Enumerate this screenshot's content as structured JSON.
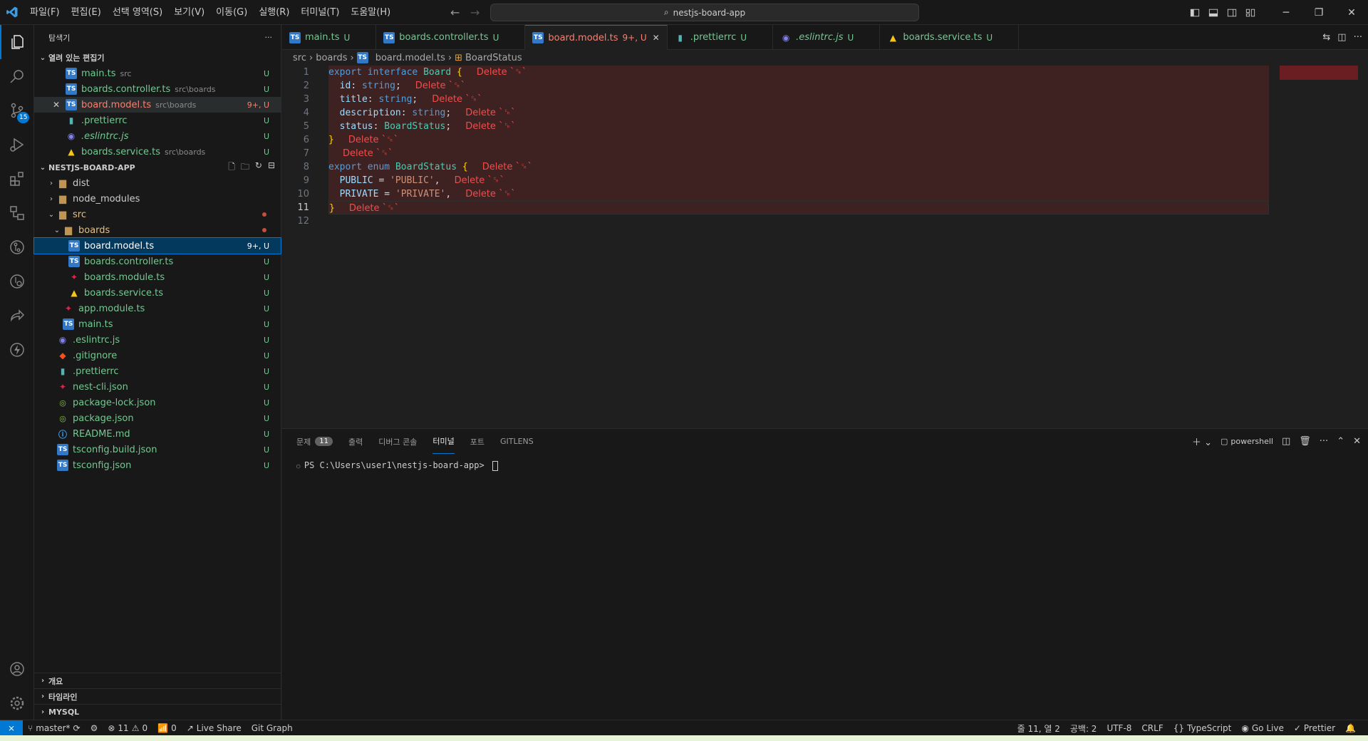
{
  "window": {
    "menu": [
      "파일(F)",
      "편집(E)",
      "선택 영역(S)",
      "보기(V)",
      "이동(G)",
      "실행(R)",
      "터미널(T)",
      "도움말(H)"
    ],
    "search_text": "nestjs-board-app"
  },
  "activity": {
    "source_control_badge": "15"
  },
  "sidebar": {
    "title": "탐색기",
    "open_editors_label": "열려 있는 편집기",
    "open_editors": [
      {
        "name": "main.ts",
        "desc": "src",
        "status": "U",
        "icon": "ts"
      },
      {
        "name": "boards.controller.ts",
        "desc": "src\\boards",
        "status": "U",
        "icon": "ts"
      },
      {
        "name": "board.model.ts",
        "desc": "src\\boards",
        "status": "9+, U",
        "icon": "ts"
      },
      {
        "name": ".prettierrc",
        "desc": "",
        "status": "U",
        "icon": "prettier"
      },
      {
        "name": ".eslintrc.js",
        "desc": "",
        "status": "U",
        "icon": "eslint"
      },
      {
        "name": "boards.service.ts",
        "desc": "src\\boards",
        "status": "U",
        "icon": "nest-service"
      }
    ],
    "project_label": "NESTJS-BOARD-APP",
    "tree": [
      {
        "name": "dist",
        "type": "folder",
        "indent": 1,
        "expanded": false
      },
      {
        "name": "node_modules",
        "type": "folder",
        "indent": 1,
        "expanded": false
      },
      {
        "name": "src",
        "type": "folder",
        "indent": 1,
        "expanded": true
      },
      {
        "name": "boards",
        "type": "folder",
        "indent": 2,
        "expanded": true
      },
      {
        "name": "board.model.ts",
        "type": "ts",
        "indent": 3,
        "status": "9+, U"
      },
      {
        "name": "boards.controller.ts",
        "type": "ts",
        "indent": 3,
        "status": "U"
      },
      {
        "name": "boards.module.ts",
        "type": "nest",
        "indent": 3,
        "status": "U"
      },
      {
        "name": "boards.service.ts",
        "type": "nest-service",
        "indent": 3,
        "status": "U"
      },
      {
        "name": "app.module.ts",
        "type": "nest",
        "indent": 2,
        "status": "U"
      },
      {
        "name": "main.ts",
        "type": "ts",
        "indent": 2,
        "status": "U"
      },
      {
        "name": ".eslintrc.js",
        "type": "eslint",
        "indent": 1,
        "status": "U"
      },
      {
        "name": ".gitignore",
        "type": "git",
        "indent": 1,
        "status": "U"
      },
      {
        "name": ".prettierrc",
        "type": "prettier",
        "indent": 1,
        "status": "U"
      },
      {
        "name": "nest-cli.json",
        "type": "nest",
        "indent": 1,
        "status": "U"
      },
      {
        "name": "package-lock.json",
        "type": "json",
        "indent": 1,
        "status": "U"
      },
      {
        "name": "package.json",
        "type": "json",
        "indent": 1,
        "status": "U"
      },
      {
        "name": "README.md",
        "type": "info",
        "indent": 1,
        "status": "U"
      },
      {
        "name": "tsconfig.build.json",
        "type": "ts",
        "indent": 1,
        "status": "U"
      },
      {
        "name": "tsconfig.json",
        "type": "ts",
        "indent": 1,
        "status": "U"
      }
    ],
    "bottom_sections": [
      "개요",
      "타임라인",
      "MYSQL"
    ]
  },
  "tabs": [
    {
      "name": "main.ts",
      "status": "U",
      "icon": "ts",
      "active": false
    },
    {
      "name": "boards.controller.ts",
      "status": "U",
      "icon": "ts",
      "active": false
    },
    {
      "name": "board.model.ts",
      "status": "9+, U",
      "icon": "ts",
      "active": true
    },
    {
      "name": ".prettierrc",
      "status": "U",
      "icon": "prettier",
      "active": false
    },
    {
      "name": ".eslintrc.js",
      "status": "U",
      "icon": "eslint",
      "active": false
    },
    {
      "name": "boards.service.ts",
      "status": "U",
      "icon": "nest-service",
      "active": false
    }
  ],
  "breadcrumb": [
    "src",
    "boards",
    "board.model.ts",
    "BoardStatus"
  ],
  "code": {
    "hint": "Delete `␍`",
    "current_line": 11,
    "lines": [
      [
        [
          "kw",
          "export"
        ],
        [
          "pu",
          " "
        ],
        [
          "kw",
          "interface"
        ],
        [
          "pu",
          " "
        ],
        [
          "ty",
          "Board"
        ],
        [
          "pu",
          " "
        ],
        [
          "brace",
          "{"
        ]
      ],
      [
        [
          "pu",
          "  "
        ],
        [
          "pr",
          "id"
        ],
        [
          "pu",
          ": "
        ],
        [
          "kw",
          "string"
        ],
        [
          "pu",
          ";"
        ]
      ],
      [
        [
          "pu",
          "  "
        ],
        [
          "pr",
          "title"
        ],
        [
          "pu",
          ": "
        ],
        [
          "kw",
          "string"
        ],
        [
          "pu",
          ";"
        ]
      ],
      [
        [
          "pu",
          "  "
        ],
        [
          "pr",
          "description"
        ],
        [
          "pu",
          ": "
        ],
        [
          "kw",
          "string"
        ],
        [
          "pu",
          ";"
        ]
      ],
      [
        [
          "pu",
          "  "
        ],
        [
          "pr",
          "status"
        ],
        [
          "pu",
          ": "
        ],
        [
          "ty",
          "BoardStatus"
        ],
        [
          "pu",
          ";"
        ]
      ],
      [
        [
          "brace",
          "}"
        ]
      ],
      [],
      [
        [
          "kw",
          "export"
        ],
        [
          "pu",
          " "
        ],
        [
          "kw",
          "enum"
        ],
        [
          "pu",
          " "
        ],
        [
          "ty",
          "BoardStatus"
        ],
        [
          "pu",
          " "
        ],
        [
          "brace",
          "{"
        ]
      ],
      [
        [
          "pu",
          "  "
        ],
        [
          "pr",
          "PUBLIC"
        ],
        [
          "pu",
          " = "
        ],
        [
          "st",
          "'PUBLIC'"
        ],
        [
          "pu",
          ","
        ]
      ],
      [
        [
          "pu",
          "  "
        ],
        [
          "pr",
          "PRIVATE"
        ],
        [
          "pu",
          " = "
        ],
        [
          "st",
          "'PRIVATE'"
        ],
        [
          "pu",
          ","
        ]
      ],
      [
        [
          "brace",
          "}"
        ]
      ],
      []
    ],
    "hinted_lines": [
      1,
      2,
      3,
      4,
      5,
      6,
      7,
      8,
      9,
      10,
      11
    ]
  },
  "panel": {
    "tabs": [
      "문제",
      "출력",
      "디버그 콘솔",
      "터미널",
      "포트",
      "GITLENS"
    ],
    "problems_count": "11",
    "active_tab": "터미널",
    "shell": "powershell",
    "prompt": "PS C:\\Users\\user1\\nestjs-board-app> "
  },
  "status": {
    "branch": "master*",
    "errors": "11",
    "warnings": "0",
    "ports": "0",
    "live_share": "Live Share",
    "git_graph": "Git Graph",
    "position": "줄 11, 열 2",
    "spaces": "공백: 2",
    "encoding": "UTF-8",
    "eol": "CRLF",
    "language": "TypeScript",
    "go_live": "Go Live",
    "prettier": "Prettier"
  },
  "colors": {
    "accent": "#0078d4",
    "untracked": "#73c991",
    "error": "#f14c4c"
  }
}
